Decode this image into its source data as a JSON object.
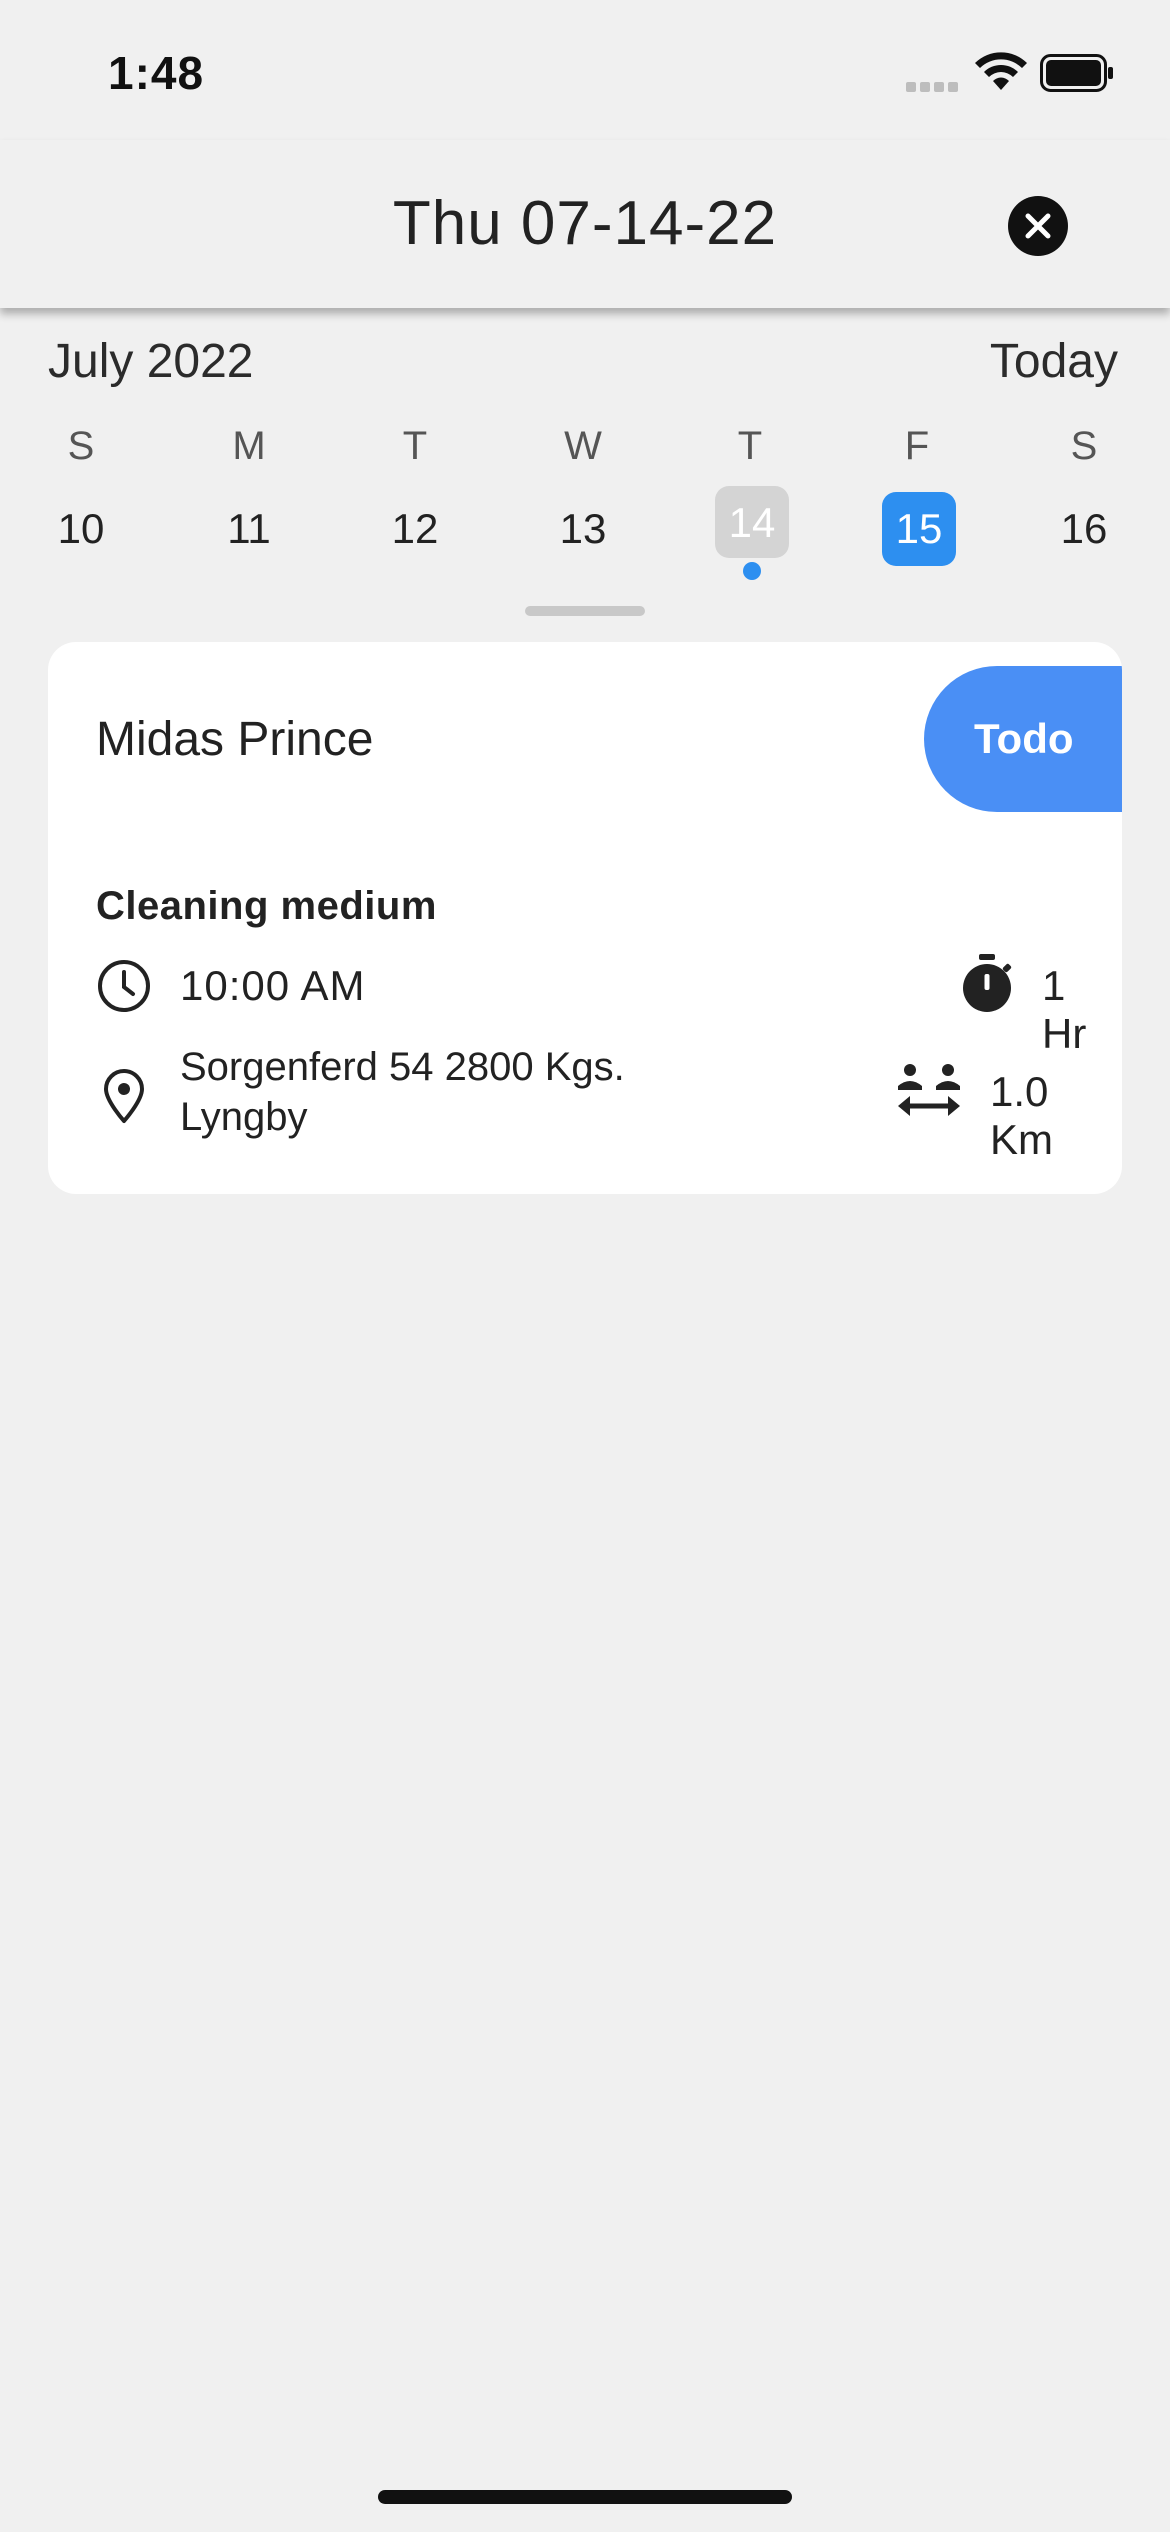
{
  "status_bar": {
    "time": "1:48"
  },
  "header": {
    "title": "Thu 07-14-22",
    "close_icon": "close-circle-icon"
  },
  "calendar": {
    "month_label": "July 2022",
    "today_label": "Today",
    "weekdays": [
      "S",
      "M",
      "T",
      "W",
      "T",
      "F",
      "S"
    ],
    "dates": [
      "10",
      "11",
      "12",
      "13",
      "14",
      "15",
      "16"
    ],
    "selected_date": "14",
    "current_date": "15",
    "colors": {
      "accent": "#2d8ff0",
      "selected_bg": "#d4d4d4"
    }
  },
  "card": {
    "client_name": "Midas Prince",
    "status": "Todo",
    "status_color": "#4a8ff5",
    "service": "Cleaning medium",
    "time": "10:00 AM",
    "duration": "1 Hr",
    "address": "Sorgenferd 54 2800 Kgs. Lyngby",
    "distance": "1.0 Km"
  }
}
